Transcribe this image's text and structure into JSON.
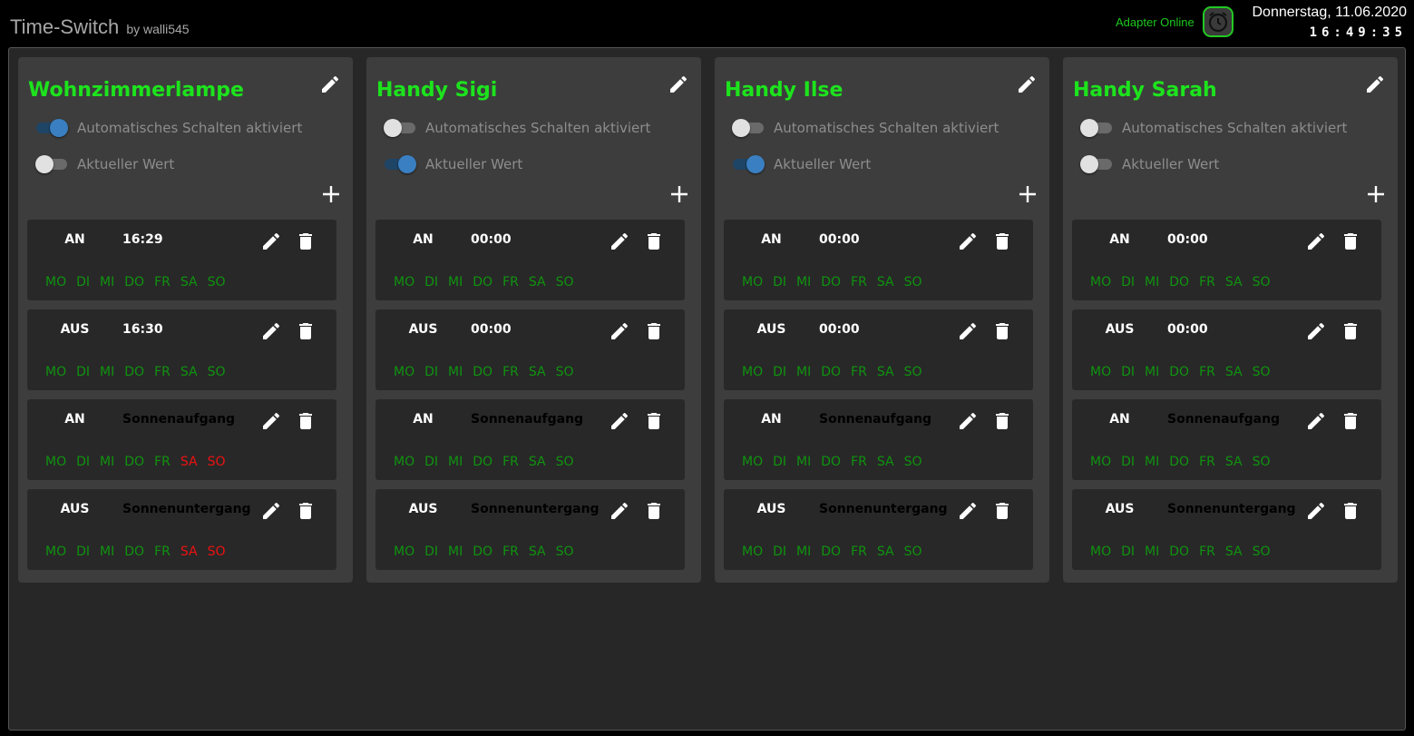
{
  "header": {
    "title": "Time-Switch",
    "by": "by walli545",
    "adapter_status": "Adapter Online",
    "date": "Donnerstag, 11.06.2020",
    "time": "16:49:35"
  },
  "colors": {
    "title_green": "#1de31d",
    "day_active": "#0f930f",
    "day_inactive": "#ee1111",
    "status_green": "#1ec81e",
    "toggle_on": "#3a7fc1"
  },
  "labels": {
    "auto_switch": "Automatisches Schalten aktiviert",
    "current_value": "Aktueller Wert"
  },
  "icons": {
    "edit": "pencil-icon",
    "delete": "trash-icon",
    "add": "plus-icon",
    "adapter": "alarm-clock-icon"
  },
  "schedules": [
    {
      "name": "Wohnzimmerlampe",
      "auto_switch_on": true,
      "current_value_on": false,
      "triggers": [
        {
          "action": "AN",
          "time": "16:29",
          "days": [
            {
              "label": "MO",
              "active": true
            },
            {
              "label": "DI",
              "active": true
            },
            {
              "label": "MI",
              "active": true
            },
            {
              "label": "DO",
              "active": true
            },
            {
              "label": "FR",
              "active": true
            },
            {
              "label": "SA",
              "active": true
            },
            {
              "label": "SO",
              "active": true
            }
          ]
        },
        {
          "action": "AUS",
          "time": "16:30",
          "days": [
            {
              "label": "MO",
              "active": true
            },
            {
              "label": "DI",
              "active": true
            },
            {
              "label": "MI",
              "active": true
            },
            {
              "label": "DO",
              "active": true
            },
            {
              "label": "FR",
              "active": true
            },
            {
              "label": "SA",
              "active": true
            },
            {
              "label": "SO",
              "active": true
            }
          ]
        },
        {
          "action": "AN",
          "time": "Sonnenaufgang",
          "days": [
            {
              "label": "MO",
              "active": true
            },
            {
              "label": "DI",
              "active": true
            },
            {
              "label": "MI",
              "active": true
            },
            {
              "label": "DO",
              "active": true
            },
            {
              "label": "FR",
              "active": true
            },
            {
              "label": "SA",
              "active": false
            },
            {
              "label": "SO",
              "active": false
            }
          ]
        },
        {
          "action": "AUS",
          "time": "Sonnenuntergang",
          "days": [
            {
              "label": "MO",
              "active": true
            },
            {
              "label": "DI",
              "active": true
            },
            {
              "label": "MI",
              "active": true
            },
            {
              "label": "DO",
              "active": true
            },
            {
              "label": "FR",
              "active": true
            },
            {
              "label": "SA",
              "active": false
            },
            {
              "label": "SO",
              "active": false
            }
          ]
        }
      ]
    },
    {
      "name": "Handy Sigi",
      "auto_switch_on": false,
      "current_value_on": true,
      "triggers": [
        {
          "action": "AN",
          "time": "00:00",
          "days": [
            {
              "label": "MO",
              "active": true
            },
            {
              "label": "DI",
              "active": true
            },
            {
              "label": "MI",
              "active": true
            },
            {
              "label": "DO",
              "active": true
            },
            {
              "label": "FR",
              "active": true
            },
            {
              "label": "SA",
              "active": true
            },
            {
              "label": "SO",
              "active": true
            }
          ]
        },
        {
          "action": "AUS",
          "time": "00:00",
          "days": [
            {
              "label": "MO",
              "active": true
            },
            {
              "label": "DI",
              "active": true
            },
            {
              "label": "MI",
              "active": true
            },
            {
              "label": "DO",
              "active": true
            },
            {
              "label": "FR",
              "active": true
            },
            {
              "label": "SA",
              "active": true
            },
            {
              "label": "SO",
              "active": true
            }
          ]
        },
        {
          "action": "AN",
          "time": "Sonnenaufgang",
          "days": [
            {
              "label": "MO",
              "active": true
            },
            {
              "label": "DI",
              "active": true
            },
            {
              "label": "MI",
              "active": true
            },
            {
              "label": "DO",
              "active": true
            },
            {
              "label": "FR",
              "active": true
            },
            {
              "label": "SA",
              "active": true
            },
            {
              "label": "SO",
              "active": true
            }
          ]
        },
        {
          "action": "AUS",
          "time": "Sonnenuntergang",
          "days": [
            {
              "label": "MO",
              "active": true
            },
            {
              "label": "DI",
              "active": true
            },
            {
              "label": "MI",
              "active": true
            },
            {
              "label": "DO",
              "active": true
            },
            {
              "label": "FR",
              "active": true
            },
            {
              "label": "SA",
              "active": true
            },
            {
              "label": "SO",
              "active": true
            }
          ]
        }
      ]
    },
    {
      "name": "Handy Ilse",
      "auto_switch_on": false,
      "current_value_on": true,
      "triggers": [
        {
          "action": "AN",
          "time": "00:00",
          "days": [
            {
              "label": "MO",
              "active": true
            },
            {
              "label": "DI",
              "active": true
            },
            {
              "label": "MI",
              "active": true
            },
            {
              "label": "DO",
              "active": true
            },
            {
              "label": "FR",
              "active": true
            },
            {
              "label": "SA",
              "active": true
            },
            {
              "label": "SO",
              "active": true
            }
          ]
        },
        {
          "action": "AUS",
          "time": "00:00",
          "days": [
            {
              "label": "MO",
              "active": true
            },
            {
              "label": "DI",
              "active": true
            },
            {
              "label": "MI",
              "active": true
            },
            {
              "label": "DO",
              "active": true
            },
            {
              "label": "FR",
              "active": true
            },
            {
              "label": "SA",
              "active": true
            },
            {
              "label": "SO",
              "active": true
            }
          ]
        },
        {
          "action": "AN",
          "time": "Sonnenaufgang",
          "days": [
            {
              "label": "MO",
              "active": true
            },
            {
              "label": "DI",
              "active": true
            },
            {
              "label": "MI",
              "active": true
            },
            {
              "label": "DO",
              "active": true
            },
            {
              "label": "FR",
              "active": true
            },
            {
              "label": "SA",
              "active": true
            },
            {
              "label": "SO",
              "active": true
            }
          ]
        },
        {
          "action": "AUS",
          "time": "Sonnenuntergang",
          "days": [
            {
              "label": "MO",
              "active": true
            },
            {
              "label": "DI",
              "active": true
            },
            {
              "label": "MI",
              "active": true
            },
            {
              "label": "DO",
              "active": true
            },
            {
              "label": "FR",
              "active": true
            },
            {
              "label": "SA",
              "active": true
            },
            {
              "label": "SO",
              "active": true
            }
          ]
        }
      ]
    },
    {
      "name": "Handy Sarah",
      "auto_switch_on": false,
      "current_value_on": false,
      "triggers": [
        {
          "action": "AN",
          "time": "00:00",
          "days": [
            {
              "label": "MO",
              "active": true
            },
            {
              "label": "DI",
              "active": true
            },
            {
              "label": "MI",
              "active": true
            },
            {
              "label": "DO",
              "active": true
            },
            {
              "label": "FR",
              "active": true
            },
            {
              "label": "SA",
              "active": true
            },
            {
              "label": "SO",
              "active": true
            }
          ]
        },
        {
          "action": "AUS",
          "time": "00:00",
          "days": [
            {
              "label": "MO",
              "active": true
            },
            {
              "label": "DI",
              "active": true
            },
            {
              "label": "MI",
              "active": true
            },
            {
              "label": "DO",
              "active": true
            },
            {
              "label": "FR",
              "active": true
            },
            {
              "label": "SA",
              "active": true
            },
            {
              "label": "SO",
              "active": true
            }
          ]
        },
        {
          "action": "AN",
          "time": "Sonnenaufgang",
          "days": [
            {
              "label": "MO",
              "active": true
            },
            {
              "label": "DI",
              "active": true
            },
            {
              "label": "MI",
              "active": true
            },
            {
              "label": "DO",
              "active": true
            },
            {
              "label": "FR",
              "active": true
            },
            {
              "label": "SA",
              "active": true
            },
            {
              "label": "SO",
              "active": true
            }
          ]
        },
        {
          "action": "AUS",
          "time": "Sonnenuntergang",
          "days": [
            {
              "label": "MO",
              "active": true
            },
            {
              "label": "DI",
              "active": true
            },
            {
              "label": "MI",
              "active": true
            },
            {
              "label": "DO",
              "active": true
            },
            {
              "label": "FR",
              "active": true
            },
            {
              "label": "SA",
              "active": true
            },
            {
              "label": "SO",
              "active": true
            }
          ]
        }
      ]
    }
  ]
}
